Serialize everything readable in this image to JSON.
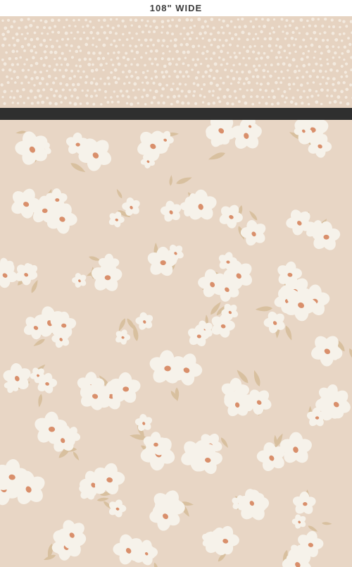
{
  "header": {
    "label": "108\" WIDE"
  },
  "colors": {
    "background": "#e8d6c5",
    "petal": "#f6f2ea",
    "center": "#d98f6b",
    "leaf": "#d8c09f",
    "divider": "#2f2f2f",
    "strip_background": "#e6d3c1"
  },
  "illustration": {
    "strip": {
      "pattern": "ditsy-floral-icon"
    },
    "main": {
      "pattern": "large-floral-icon"
    }
  }
}
